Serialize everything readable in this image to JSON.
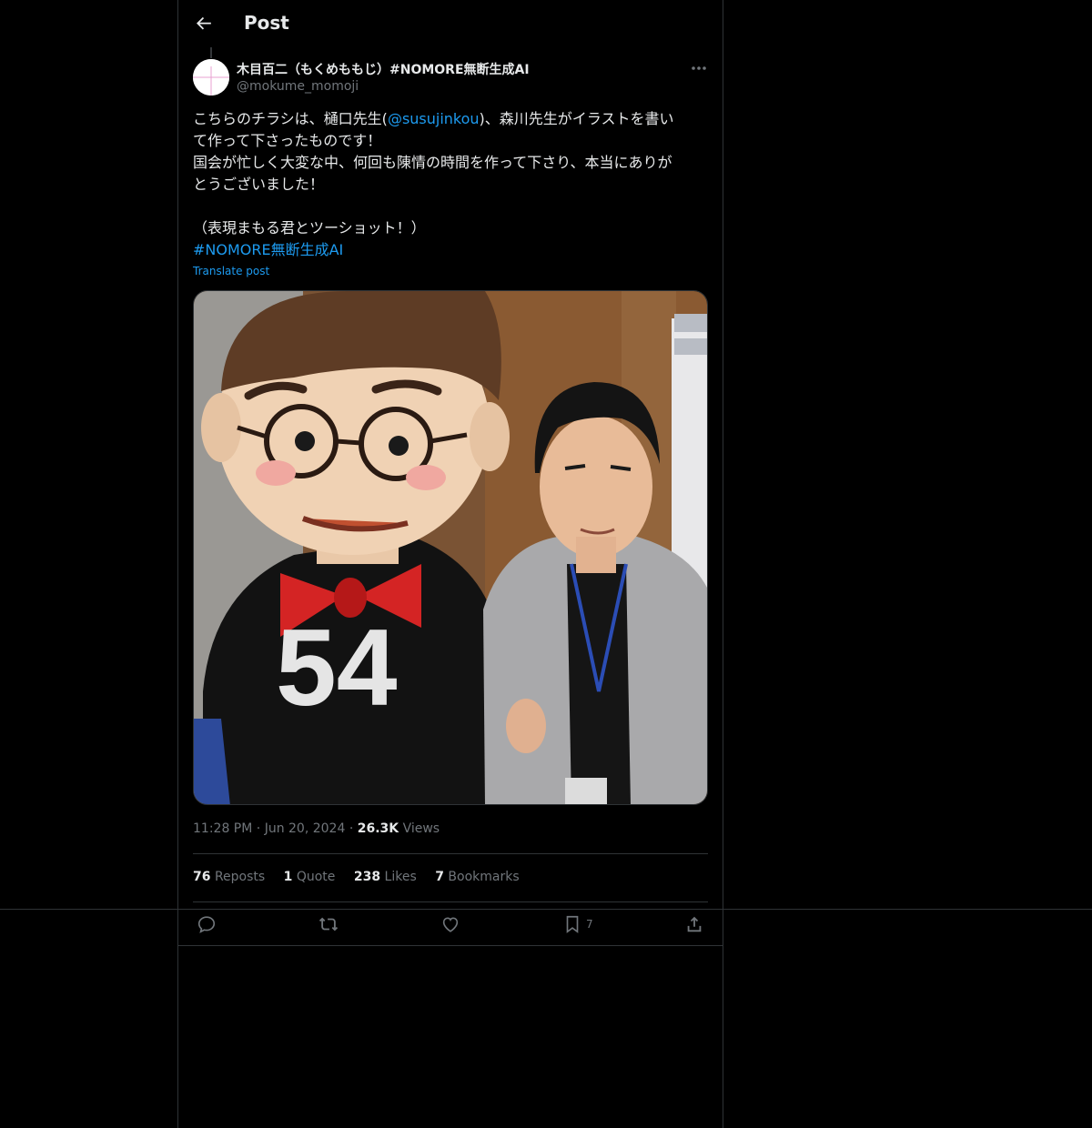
{
  "header": {
    "title": "Post",
    "back_icon": "arrow-left-icon"
  },
  "author": {
    "display_name": "木目百二（もくめももじ）#NOMORE無断生成AI",
    "handle": "@mokume_momoji",
    "more_icon": "more-dots-icon"
  },
  "tweet": {
    "line1_a": "こちらのチラシは、樋口先生(",
    "mention": "@susujinkou",
    "line1_b": ")、森川先生がイラストを書い",
    "line2": "て作って下さったものです！",
    "line3": "国会が忙しく大変な中、何回も陳情の時間を作って下さり、本当にありが",
    "line4": "とうございました！",
    "line5": "（表現まもる君とツーショット！）",
    "hashtag": "#NOMORE無断生成AI",
    "translate": "Translate post"
  },
  "media": {
    "jersey_number": "54"
  },
  "meta": {
    "time": "11:28 PM",
    "date": "Jun 20, 2024",
    "views_count": "26.3K",
    "views_label": "Views",
    "dot": "·"
  },
  "stats": {
    "reposts_count": "76",
    "reposts_label": "Reposts",
    "quote_count": "1",
    "quote_label": "Quote",
    "likes_count": "238",
    "likes_label": "Likes",
    "bookmarks_count": "7",
    "bookmarks_label": "Bookmarks"
  },
  "actions": {
    "reply_icon": "reply-icon",
    "repost_icon": "repost-icon",
    "like_icon": "heart-icon",
    "bookmark_icon": "bookmark-icon",
    "bookmark_count": "7",
    "share_icon": "share-icon"
  },
  "colors": {
    "background": "#000000",
    "text": "#e7e9ea",
    "secondary": "#71767b",
    "accent": "#1d9bf0",
    "border": "#2f3336"
  }
}
